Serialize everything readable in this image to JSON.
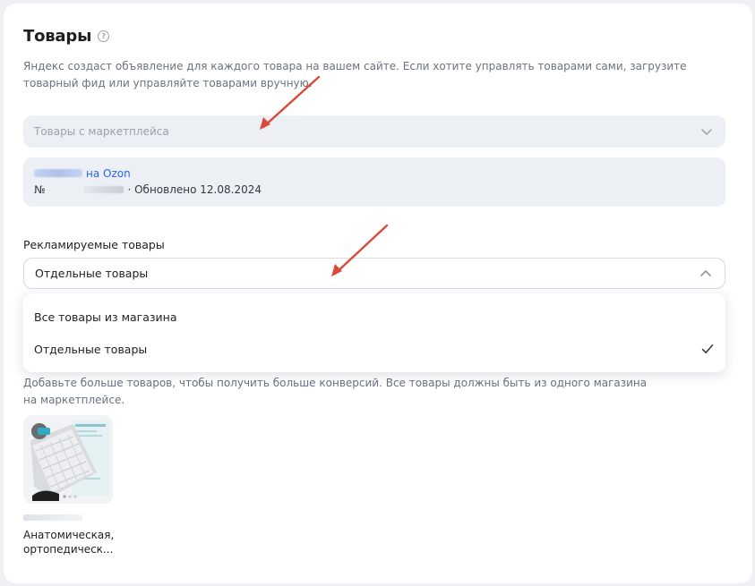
{
  "section": {
    "title": "Товары",
    "description": "Яндекс создаст объявление для каждого товара на вашем сайте. Если хотите управлять товарами сами, загрузите товарный фид или управляйте товарами вручную."
  },
  "source_select": {
    "placeholder": "Товары с маркетплейса",
    "icon": "chevron-down-icon"
  },
  "store": {
    "link_text": "на Ozon",
    "number_prefix": "№",
    "updated": "· Обновлено 12.08.2024"
  },
  "advertised": {
    "label": "Рекламируемые товары",
    "selected": "Отдельные товары",
    "options": [
      {
        "label": "Все товары из магазина",
        "selected": false
      },
      {
        "label": "Отдельные товары",
        "selected": true
      }
    ]
  },
  "hint": "Добавьте больше товаров, чтобы получить больше конверсий. Все товары должны быть из одного магазина на маркетплейсе.",
  "product": {
    "name": "Анатомическая, ортопедическ..."
  },
  "colors": {
    "accent_link": "#2c62f4",
    "annotation_arrow": "#d94a3a"
  }
}
